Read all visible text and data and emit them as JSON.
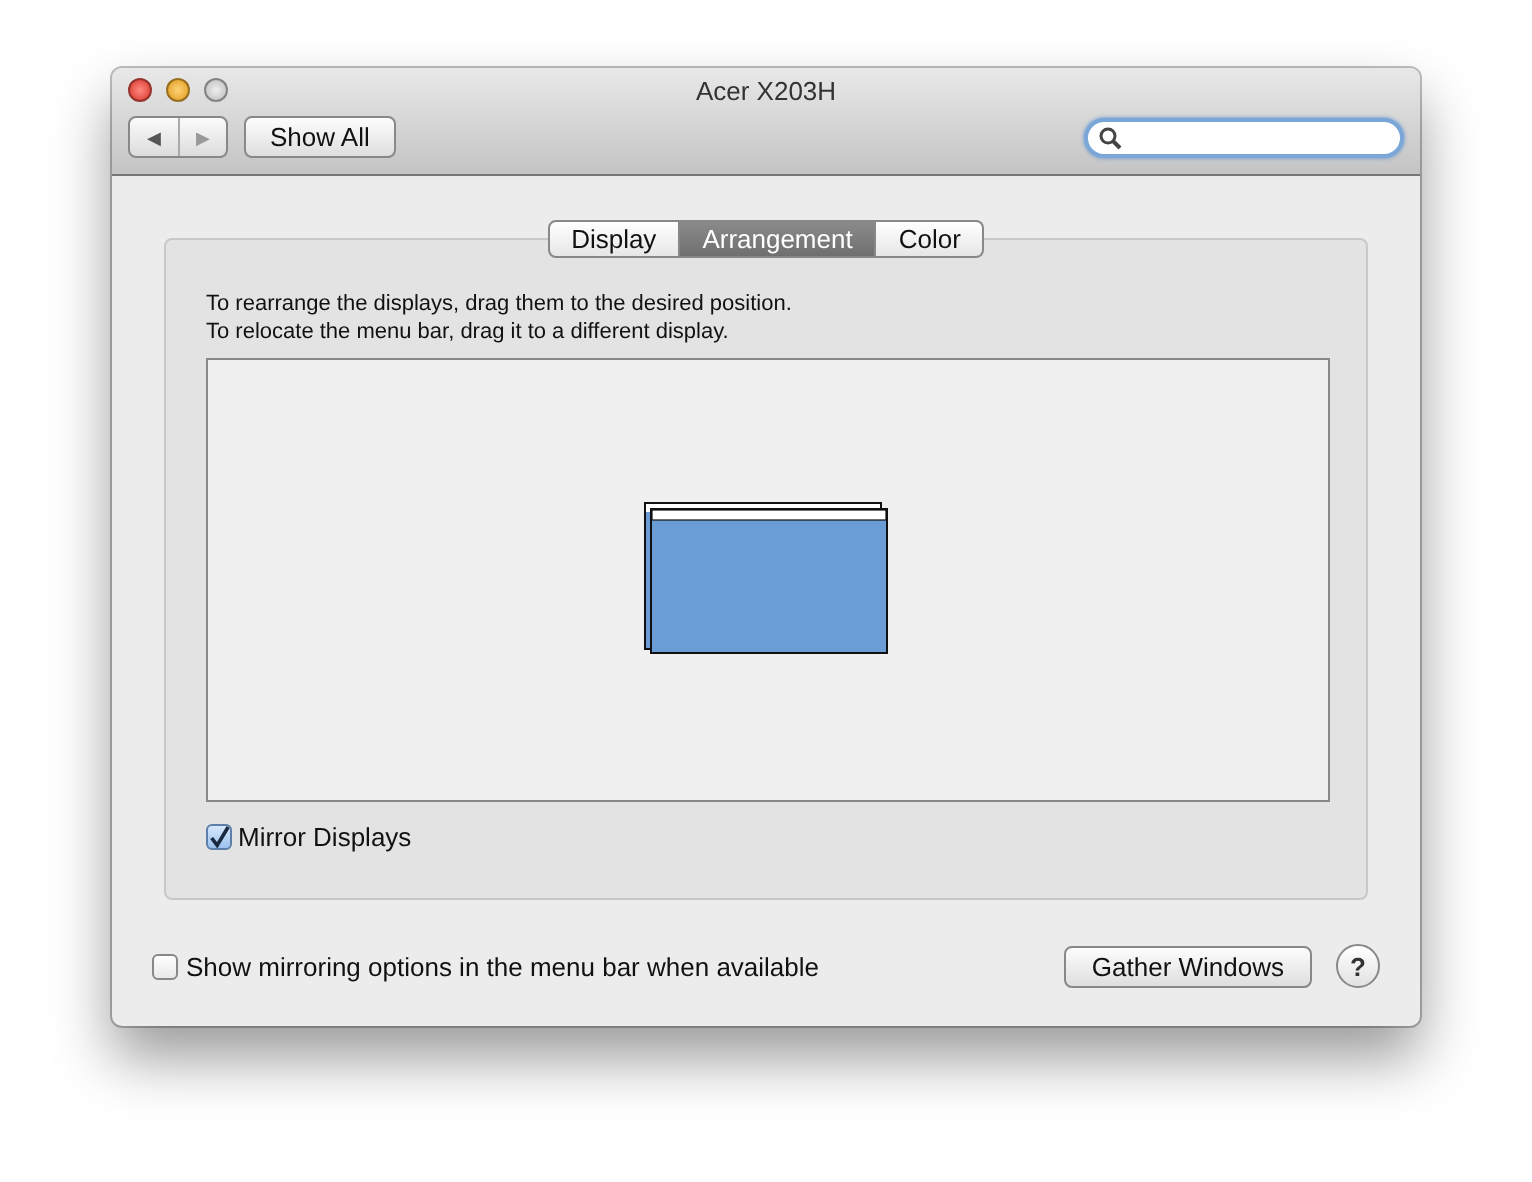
{
  "window": {
    "title": "Acer X203H"
  },
  "toolbar": {
    "back_label": "◀",
    "forward_label": "▶",
    "show_all": "Show All"
  },
  "tabs": [
    {
      "label": "Display",
      "selected": false
    },
    {
      "label": "Arrangement",
      "selected": true
    },
    {
      "label": "Color",
      "selected": false
    }
  ],
  "instructions": [
    "To rearrange the displays, drag them to the desired position.",
    "To relocate the menu bar, drag it to a different display."
  ],
  "mirror_displays": {
    "label": "Mirror Displays",
    "checked": true
  },
  "show_mirroring": {
    "label": "Show mirroring options in the menu bar when available",
    "checked": false
  },
  "gather_windows": "Gather Windows",
  "help": "?"
}
